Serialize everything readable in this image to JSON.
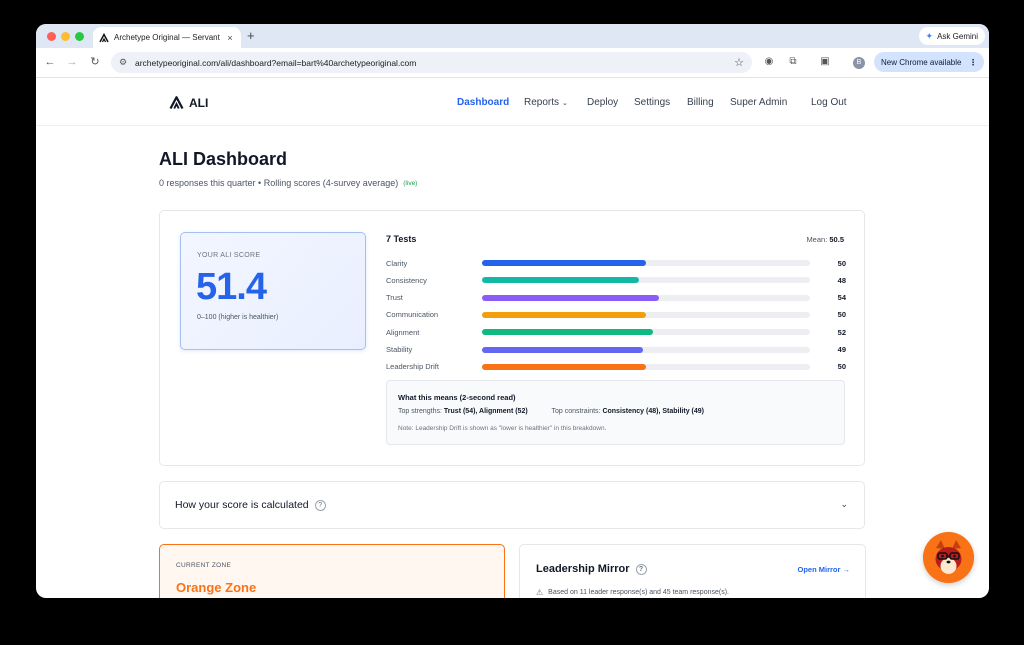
{
  "browser": {
    "tab_title": "Archetype Original — Servant",
    "tab_close": "×",
    "new_tab": "+",
    "gemini_label": "Ask Gemini",
    "url": "archetypeoriginal.com/ali/dashboard?email=bart%40archetypeoriginal.com",
    "profile_initial": "B",
    "new_chrome_label": "New Chrome available"
  },
  "header": {
    "logo_text": "ALI",
    "nav": {
      "dashboard": "Dashboard",
      "reports": "Reports",
      "deploy": "Deploy",
      "settings": "Settings",
      "billing": "Billing",
      "super_admin": "Super Admin",
      "logout": "Log Out"
    }
  },
  "page": {
    "title": "ALI Dashboard",
    "subtitle": "0 responses this quarter • Rolling scores (4-survey average)",
    "live_badge": "(live)"
  },
  "score": {
    "label": "YOUR ALI SCORE",
    "value": "51.4",
    "note": "0–100 (higher is healthier)"
  },
  "tests": {
    "heading": "7 Tests",
    "mean_label": "Mean:",
    "mean_value": "50.5",
    "items": [
      {
        "label": "Clarity",
        "value": 50,
        "display": "50",
        "color": "#2563eb"
      },
      {
        "label": "Consistency",
        "value": 48,
        "display": "48",
        "color": "#14b8a6"
      },
      {
        "label": "Trust",
        "value": 54,
        "display": "54",
        "color": "#8b5cf6"
      },
      {
        "label": "Communication",
        "value": 50,
        "display": "50",
        "color": "#f59e0b"
      },
      {
        "label": "Alignment",
        "value": 52,
        "display": "52",
        "color": "#10b981"
      },
      {
        "label": "Stability",
        "value": 49,
        "display": "49",
        "color": "#6366f1"
      },
      {
        "label": "Leadership Drift",
        "value": 50,
        "display": "50",
        "color": "#f97316"
      }
    ]
  },
  "meaning": {
    "title": "What this means (2-second read)",
    "strengths_label": "Top strengths:",
    "strengths_value": "Trust (54), Alignment (52)",
    "constraints_label": "Top constraints:",
    "constraints_value": "Consistency (48), Stability (49)",
    "note": "Note: Leadership Drift is shown as \"lower is healthier\" in this breakdown."
  },
  "calc": {
    "title": "How your score is calculated",
    "help": "?"
  },
  "zone": {
    "label": "CURRENT ZONE",
    "name": "Orange Zone"
  },
  "mirror": {
    "title": "Leadership Mirror",
    "help": "?",
    "link": "Open Mirror →",
    "note": "Based on 11 leader response(s) and 45 team response(s)."
  }
}
